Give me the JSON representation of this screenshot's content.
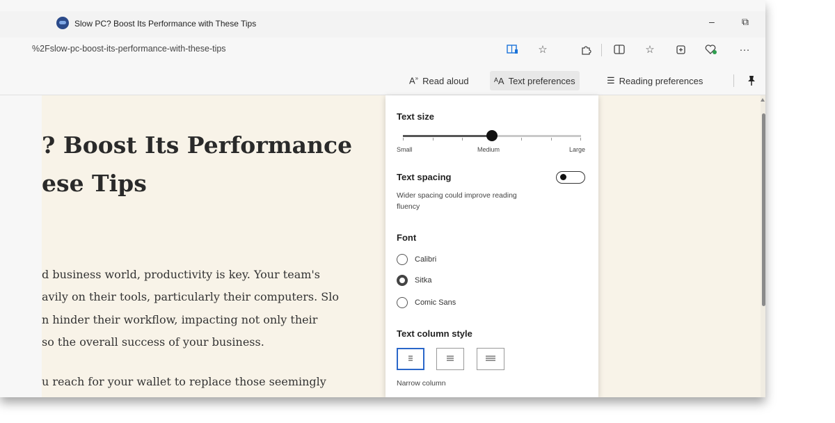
{
  "tab": {
    "title": "Slow PC? Boost Its Performance with These Tips"
  },
  "window_controls": {
    "minimize": "–",
    "restore": "⧉"
  },
  "address_bar": {
    "url": "%2Fslow-pc-boost-its-performance-with-these-tips"
  },
  "toolbar_icons": [
    "immersive-reader-icon",
    "favorite-star-icon",
    "extensions-icon",
    "split-screen-icon",
    "favorites-list-icon",
    "collections-icon",
    "browser-essentials-icon",
    "more-icon"
  ],
  "reader_toolbar": {
    "read_aloud": "Read aloud",
    "text_preferences": "Text preferences",
    "reading_preferences": "Reading preferences"
  },
  "article": {
    "headline_line1": "? Boost Its Performance",
    "headline_line2": "ese Tips",
    "para1": [
      "d business world, productivity is key. Your team's",
      "avily on their tools, particularly their computers. Slo",
      "n hinder their workflow, impacting not only their",
      "so the overall success of your business."
    ],
    "para2": "u reach for your wallet to replace those seemingly"
  },
  "text_prefs": {
    "text_size": {
      "title": "Text size",
      "labels": {
        "small": "Small",
        "medium": "Medium",
        "large": "Large"
      },
      "value_fraction": 0.5
    },
    "text_spacing": {
      "title": "Text spacing",
      "desc_line1": "Wider spacing could improve reading",
      "desc_line2": "fluency",
      "enabled": false
    },
    "font": {
      "title": "Font",
      "options": [
        "Calibri",
        "Sitka",
        "Comic Sans"
      ],
      "selected": "Sitka"
    },
    "column_style": {
      "title": "Text column style",
      "selected_label": "Narrow column"
    }
  }
}
